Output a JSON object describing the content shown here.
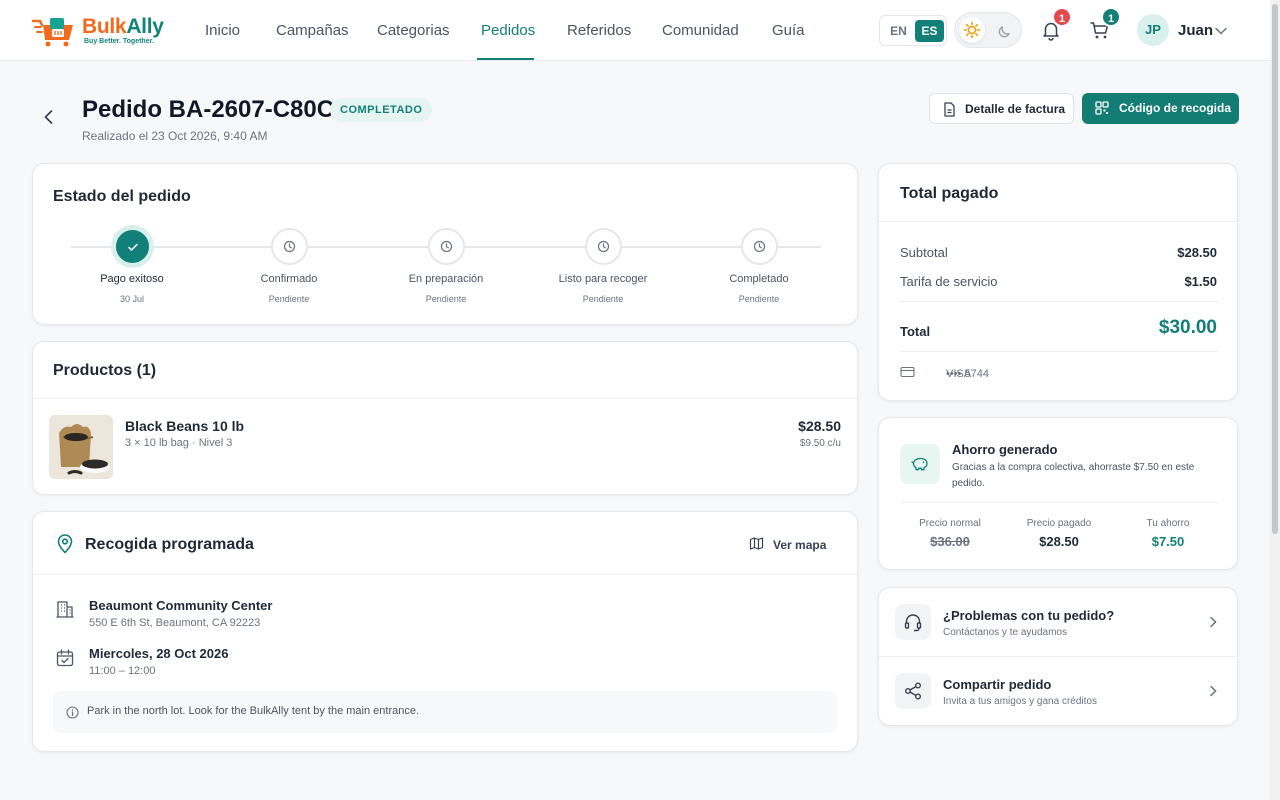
{
  "nav": {
    "logo": {
      "word1": "Bulk",
      "word2": "Ally",
      "tagline": "Buy Better. Together."
    },
    "links": [
      "Inicio",
      "Campañas",
      "Categorias",
      "Pedidos",
      "Referidos",
      "Comunidad",
      "Guía"
    ],
    "active_link": "Pedidos",
    "lang_en": "EN",
    "lang_es": "ES",
    "notifications_count": "1",
    "cart_count": "1",
    "avatar_initials": "JP",
    "user_name": "Juan"
  },
  "header": {
    "title": "Pedido BA-2607-C80C",
    "status": "COMPLETADO",
    "placed": "Realizado el 23 Oct 2026, 9:40 AM",
    "invoice_button": "Detalle de factura",
    "pickup_code_button": "Código de recogida"
  },
  "order_status": {
    "title": "Estado del pedido",
    "steps": [
      {
        "label": "Pago exitoso",
        "date": "30 Jul",
        "done": true
      },
      {
        "label": "Confirmado",
        "date": "Pendiente",
        "done": false
      },
      {
        "label": "En preparación",
        "date": "Pendiente",
        "done": false
      },
      {
        "label": "Listo para recoger",
        "date": "Pendiente",
        "done": false
      },
      {
        "label": "Completado",
        "date": "Pendiente",
        "done": false
      }
    ]
  },
  "products": {
    "title": "Productos (1)",
    "items": [
      {
        "name": "Black Beans 10 lb",
        "detail": "3 × 10 lb bag · Nivel 3",
        "price": "$28.50",
        "unit_price": "$9.50 c/u"
      }
    ]
  },
  "pickup": {
    "title": "Recogida programada",
    "map_button": "Ver mapa",
    "location_name": "Beaumont Community Center",
    "location_address": "550 E 6th St, Beaumont, CA 92223",
    "date": "Miercoles, 28 Oct 2026",
    "time": "11:00 – 12:00",
    "note": "Park in the north lot. Look for the BulkAlly tent by the main entrance."
  },
  "payment": {
    "title": "Total pagado",
    "subtotal_label": "Subtotal",
    "subtotal": "$28.50",
    "fee_label": "Tarifa de servicio",
    "fee": "$1.50",
    "total_label": "Total",
    "total": "$30.00",
    "card_brand": "VISA",
    "card_masked": "•••• 5744"
  },
  "savings": {
    "title": "Ahorro generado",
    "description": "Gracias a la compra colectiva, ahorraste $7.50 en este pedido.",
    "normal_label": "Precio normal",
    "normal": "$36.00",
    "paid_label": "Precio pagado",
    "paid": "$28.50",
    "saved_label": "Tu ahorro",
    "saved": "$7.50"
  },
  "help": {
    "problems_title": "¿Problemas con tu pedido?",
    "problems_sub": "Contáctanos y te ayudamos",
    "share_title": "Compartir pedido",
    "share_sub": "Invita a tus amigos y gana créditos"
  },
  "colors": {
    "brand_teal": "#127f78",
    "brand_orange": "#f26b1d",
    "alert_red": "#e5484d"
  }
}
